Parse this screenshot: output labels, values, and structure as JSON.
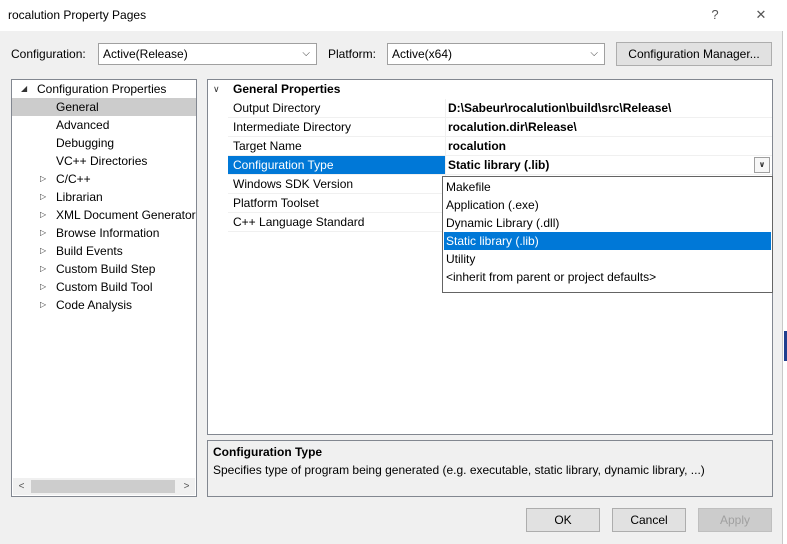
{
  "window": {
    "title": "rocalution Property Pages",
    "help_glyph": "?",
    "close_glyph": "✕"
  },
  "toolbar": {
    "configuration_label": "Configuration:",
    "configuration_value": "Active(Release)",
    "platform_label": "Platform:",
    "platform_value": "Active(x64)",
    "config_manager_label": "Configuration Manager..."
  },
  "tree": {
    "root_label": "Configuration Properties",
    "items": [
      {
        "label": "General",
        "selected": true,
        "expandable": false
      },
      {
        "label": "Advanced",
        "expandable": false
      },
      {
        "label": "Debugging",
        "expandable": false
      },
      {
        "label": "VC++ Directories",
        "expandable": false
      },
      {
        "label": "C/C++",
        "expandable": true
      },
      {
        "label": "Librarian",
        "expandable": true
      },
      {
        "label": "XML Document Generator",
        "expandable": true
      },
      {
        "label": "Browse Information",
        "expandable": true
      },
      {
        "label": "Build Events",
        "expandable": true
      },
      {
        "label": "Custom Build Step",
        "expandable": true
      },
      {
        "label": "Custom Build Tool",
        "expandable": true
      },
      {
        "label": "Code Analysis",
        "expandable": true
      }
    ]
  },
  "grid": {
    "category_label": "General Properties",
    "properties": [
      {
        "name": "Output Directory",
        "value": "D:\\Sabeur\\rocalution\\build\\src\\Release\\"
      },
      {
        "name": "Intermediate Directory",
        "value": "rocalution.dir\\Release\\"
      },
      {
        "name": "Target Name",
        "value": "rocalution"
      },
      {
        "name": "Configuration Type",
        "value": "Static library (.lib)",
        "selected": true
      },
      {
        "name": "Windows SDK Version",
        "value": ""
      },
      {
        "name": "Platform Toolset",
        "value": ""
      },
      {
        "name": "C++ Language Standard",
        "value": ""
      }
    ]
  },
  "dropdown": {
    "options": [
      "Makefile",
      "Application (.exe)",
      "Dynamic Library (.dll)",
      "Static library (.lib)",
      "Utility",
      "<inherit from parent or project defaults>"
    ],
    "selected": "Static library (.lib)"
  },
  "description": {
    "title": "Configuration Type",
    "text": "Specifies type of program being generated (e.g. executable, static library, dynamic library, ...)"
  },
  "buttons": {
    "ok": "OK",
    "cancel": "Cancel",
    "apply": "Apply"
  },
  "colors": {
    "selection": "#0078d7",
    "tree_selection": "#cccccc",
    "dialog_bg": "#f0f0f0"
  }
}
